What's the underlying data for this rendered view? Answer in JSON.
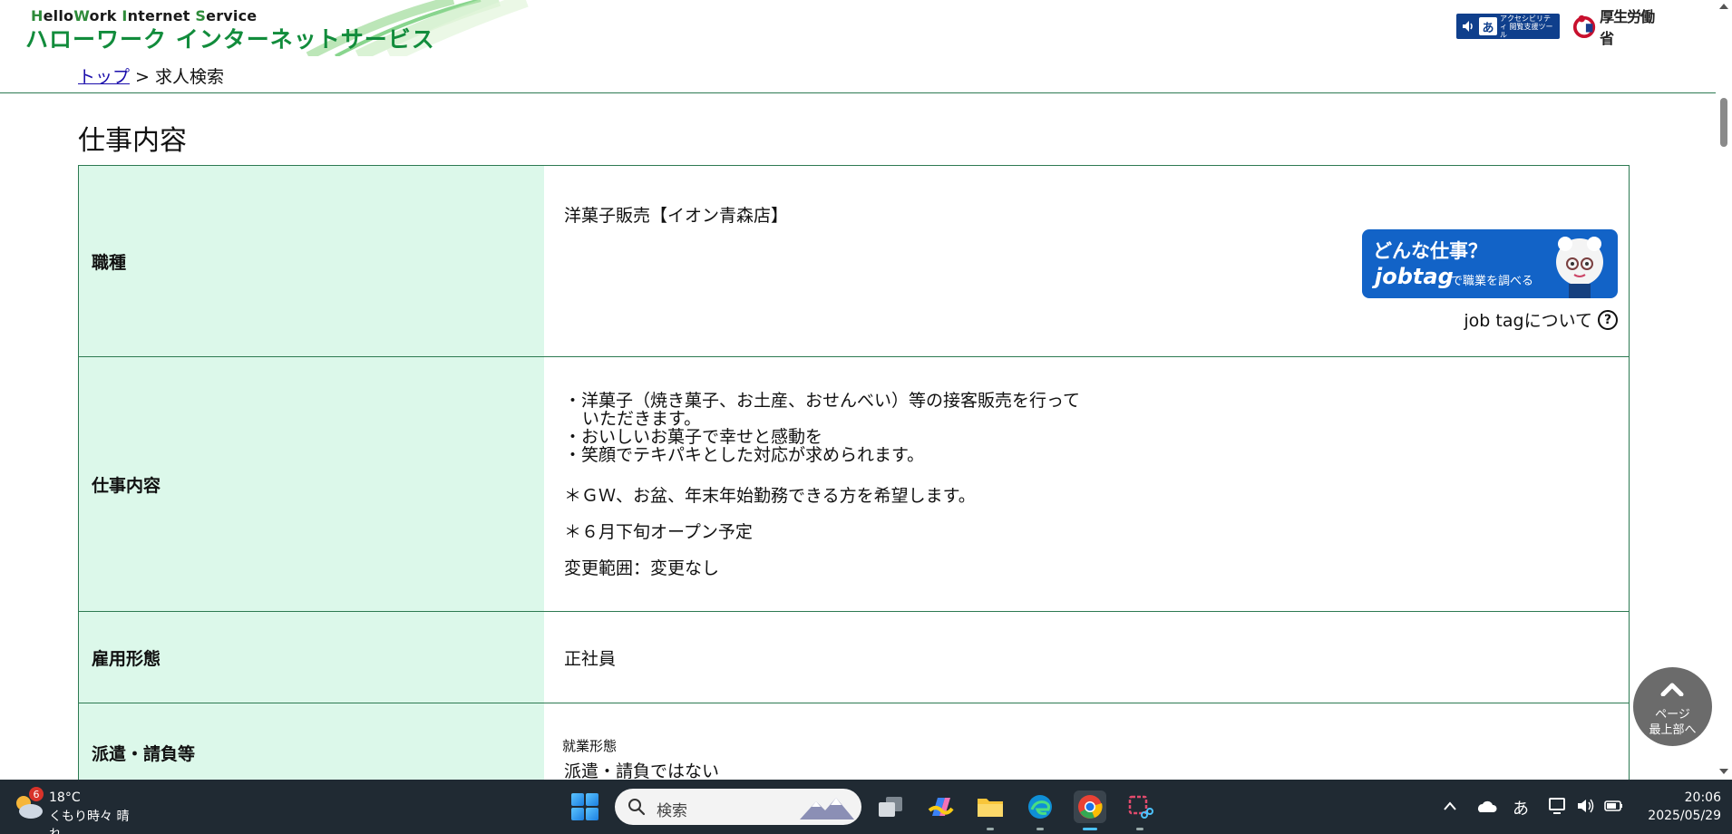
{
  "header": {
    "logo_en_parts": [
      "H",
      "ello",
      "W",
      "ork ",
      "I",
      "nternet ",
      "S",
      "ervice"
    ],
    "logo_jp": "ハローワーク インターネットサービス",
    "access_tool_glyph": "あ",
    "access_tool_label": "アクセシビリティ 閲覧支援ツール",
    "ministry_name": "厚生労働省"
  },
  "breadcrumb": {
    "home": "トップ",
    "separator": " > ",
    "current": "求人検索"
  },
  "section_title": "仕事内容",
  "table": {
    "rows": [
      {
        "label": "職種",
        "value": "洋菓子販売【イオン青森店】"
      },
      {
        "label": "仕事内容"
      },
      {
        "label": "雇用形態",
        "value": "正社員"
      },
      {
        "label": "派遣・請負等",
        "sub_label": "就業形態",
        "value": "派遣・請負ではない"
      }
    ],
    "job_description": {
      "line1": "・洋菓子（焼き菓子、お土産、おせんべい）等の接客販売を行って",
      "line2": "いただきます。",
      "line3": "・おいしいお菓子で幸せと感動を",
      "line4": "・笑顔でテキパキとした対応が求められます。",
      "note1": "＊ＧＷ、お盆、年末年始勤務できる方を希望します。",
      "note2": "＊６月下旬オープン予定",
      "note3": "変更範囲：変更なし"
    }
  },
  "jobtag": {
    "question": "どんな仕事？",
    "logo": "jobtag",
    "subtitle": "で職業を調べる",
    "help_text": "job tagについて",
    "help_glyph": "?"
  },
  "back_to_top": {
    "line1": "ページ",
    "line2": "最上部へ"
  },
  "taskbar": {
    "weather_badge": "6",
    "temperature": "18°C",
    "condition": "くもり時々 晴れ",
    "search_placeholder": "検索",
    "ime": "あ",
    "time": "20:06",
    "date": "2025/05/29"
  },
  "colors": {
    "header_green": "#128c3c",
    "table_border": "#2d7a52",
    "label_bg": "#dcf8ea",
    "jobtag_blue": "#1263c7",
    "taskbar_bg": "#202a33"
  }
}
